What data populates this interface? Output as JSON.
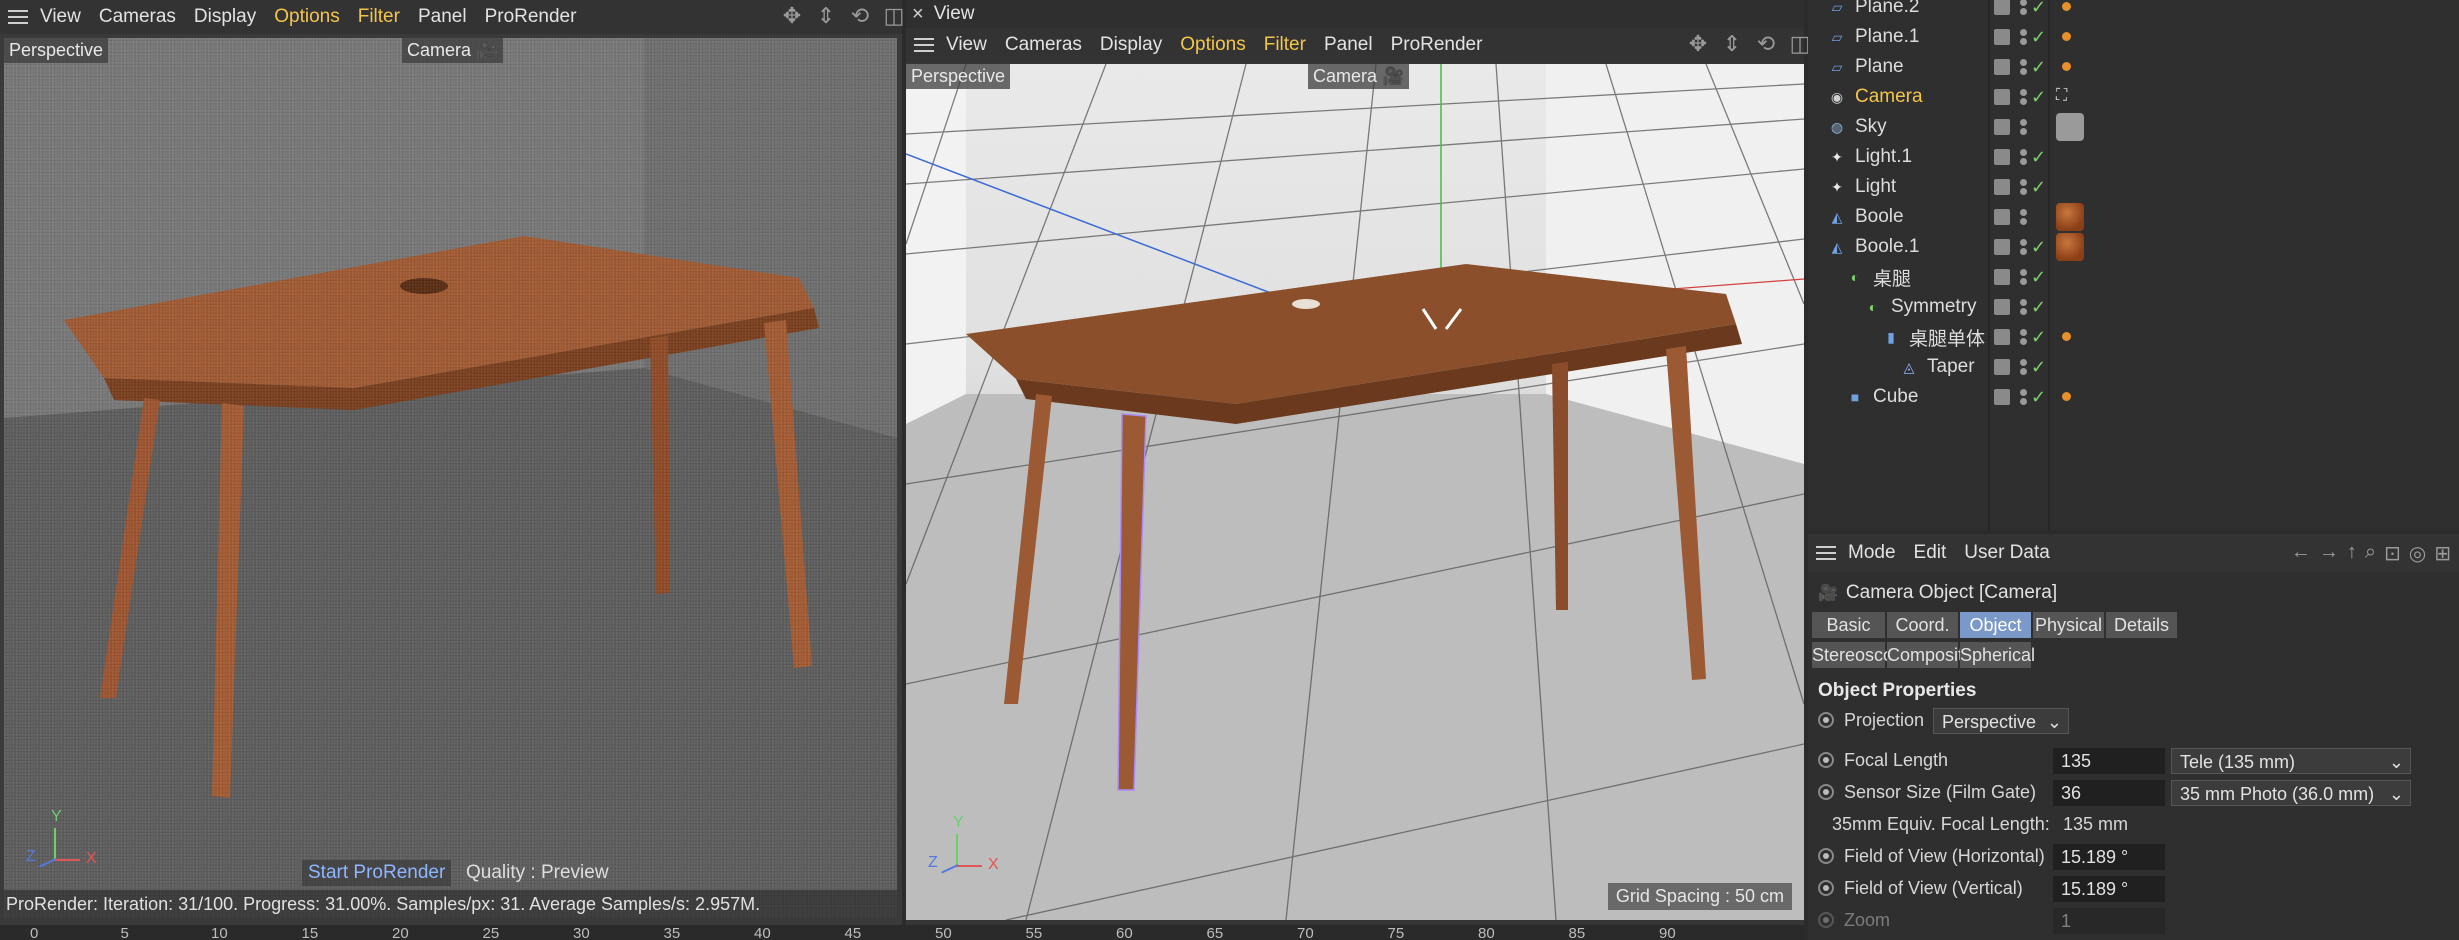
{
  "left_viewport": {
    "menu": [
      "View",
      "Cameras",
      "Display",
      "Options",
      "Filter",
      "Panel",
      "ProRender"
    ],
    "highlighted_menu": [
      "Options",
      "Filter"
    ],
    "label_perspective": "Perspective",
    "label_camera": "Camera",
    "start_prorender": "Start ProRender",
    "quality": "Quality : Preview",
    "status": "ProRender: Iteration: 31/100. Progress: 31.00%. Samples/px: 31. Average Samples/s: 2.957M.",
    "axis_y": "Y",
    "axis_z": "Z",
    "axis_x": "X"
  },
  "right_viewport": {
    "title": "View",
    "close_glyph": "×",
    "menu": [
      "View",
      "Cameras",
      "Display",
      "Options",
      "Filter",
      "Panel",
      "ProRender"
    ],
    "label_perspective": "Perspective",
    "label_camera": "Camera",
    "grid_spacing": "Grid Spacing : 50 cm",
    "axis_y": "Y",
    "axis_z": "Z",
    "axis_x": "X"
  },
  "object_manager": {
    "objects": [
      {
        "name": "Plane.2",
        "icon": "plane-icon",
        "indent": 0,
        "partial": true
      },
      {
        "name": "Plane.1",
        "icon": "plane-icon",
        "indent": 0
      },
      {
        "name": "Plane",
        "icon": "plane-icon",
        "indent": 0
      },
      {
        "name": "Camera",
        "icon": "camera-icon",
        "indent": 0,
        "selected": true
      },
      {
        "name": "Sky",
        "icon": "sky-icon",
        "indent": 0
      },
      {
        "name": "Light.1",
        "icon": "light-icon",
        "indent": 0
      },
      {
        "name": "Light",
        "icon": "light-icon",
        "indent": 0
      },
      {
        "name": "Boole",
        "icon": "boole-icon",
        "indent": 0
      },
      {
        "name": "Boole.1",
        "icon": "boole-icon",
        "indent": 0
      },
      {
        "name": "桌腿",
        "icon": "symmetry-icon",
        "indent": 1
      },
      {
        "name": "Symmetry",
        "icon": "symmetry-icon",
        "indent": 2
      },
      {
        "name": "桌腿单体",
        "icon": "cylinder-icon",
        "indent": 3
      },
      {
        "name": "Taper",
        "icon": "taper-icon",
        "indent": 4
      },
      {
        "name": "Cube",
        "icon": "cube-icon",
        "indent": 1
      }
    ]
  },
  "attribute_manager": {
    "menu": [
      "Mode",
      "Edit",
      "User Data"
    ],
    "object_title": "Camera Object [Camera]",
    "tabs_row1": [
      "Basic",
      "Coord.",
      "Object",
      "Physical",
      "Details"
    ],
    "tabs_row2": [
      "Stereoscopic",
      "Composition",
      "Spherical"
    ],
    "active_tab": "Object",
    "section_title": "Object Properties",
    "projection_label": "Projection",
    "projection_value": "Perspective",
    "focal_length_label": "Focal Length",
    "focal_length_value": "135",
    "focal_length_preset": "Tele (135 mm)",
    "sensor_label": "Sensor Size (Film Gate)",
    "sensor_value": "36",
    "sensor_preset": "35 mm Photo (36.0 mm)",
    "equiv_label": "35mm Equiv. Focal Length:",
    "equiv_value": "135 mm",
    "fov_h_label": "Field of View (Horizontal)",
    "fov_h_value": "15.189 °",
    "fov_v_label": "Field of View (Vertical)",
    "fov_v_value": "15.189 °",
    "zoom_label": "Zoom",
    "zoom_value": "1"
  },
  "timeline": {
    "ticks": [
      "0",
      "5",
      "10",
      "15",
      "20",
      "25",
      "30",
      "35",
      "40",
      "45",
      "50",
      "55",
      "60",
      "65",
      "70",
      "75",
      "80",
      "85",
      "90"
    ]
  },
  "colors": {
    "highlight": "#f2c54b",
    "active_tab": "#7a98c8",
    "check": "#7fd36b"
  }
}
